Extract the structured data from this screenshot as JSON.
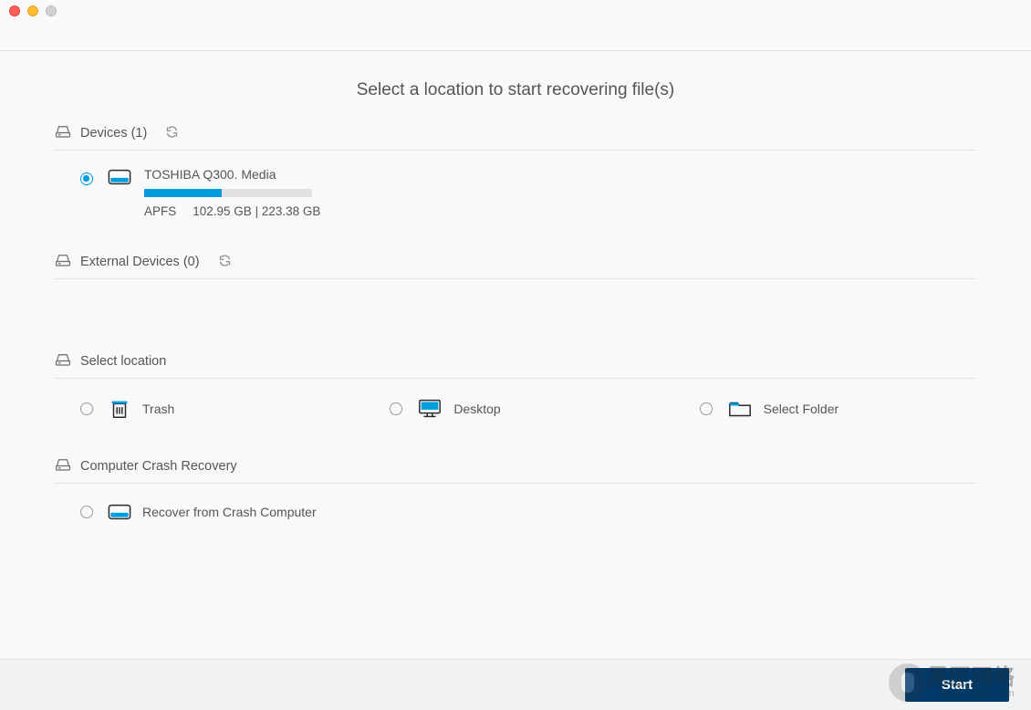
{
  "colors": {
    "accent": "#009cde",
    "button": "#003a6b"
  },
  "page": {
    "title": "Select a location to start recovering file(s)"
  },
  "sections": {
    "devices_label": "Devices (1)",
    "external_label": "External Devices (0)",
    "location_label": "Select location",
    "crash_label": "Computer Crash Recovery"
  },
  "device": {
    "name": "TOSHIBA Q300. Media",
    "fs": "APFS",
    "used": "102.95 GB",
    "total": "223.38 GB",
    "usage_percent": 46
  },
  "locations": {
    "trash": "Trash",
    "desktop": "Desktop",
    "select_folder": "Select Folder"
  },
  "crash": {
    "option_label": "Recover from Crash Computer"
  },
  "footer": {
    "start": "Start"
  },
  "watermark": {
    "line1": "黑区网络",
    "line2": "www.heiqu.com"
  }
}
